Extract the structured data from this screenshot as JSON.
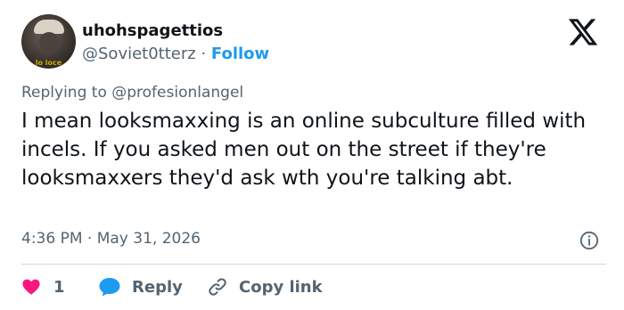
{
  "author": {
    "display_name": "uhohspagettios",
    "handle": "@Soviet0tterz",
    "separator": " · ",
    "follow_label": "Follow",
    "avatar_caption": "lo loce"
  },
  "reply_context": {
    "prefix": "Replying to ",
    "mention": "@profesionlangel"
  },
  "tweet": {
    "text": "I mean looksmaxxing is an online subculture filled with incels. If you asked men out on the street if they're looksmaxxers they'd ask wth you're talking abt.",
    "timestamp": "4:36 PM · May 31, 2026"
  },
  "actions": {
    "like_count": "1",
    "reply_label": "Reply",
    "copy_label": "Copy link"
  },
  "icons": {
    "brand": "x-logo-icon",
    "info": "info-icon",
    "like": "heart-icon",
    "reply": "speech-bubble-icon",
    "copy": "link-icon"
  },
  "colors": {
    "text": "#0f1419",
    "secondary": "#536471",
    "accent": "#1d9bf0",
    "like": "#f91880",
    "divider": "#cfd9de"
  }
}
